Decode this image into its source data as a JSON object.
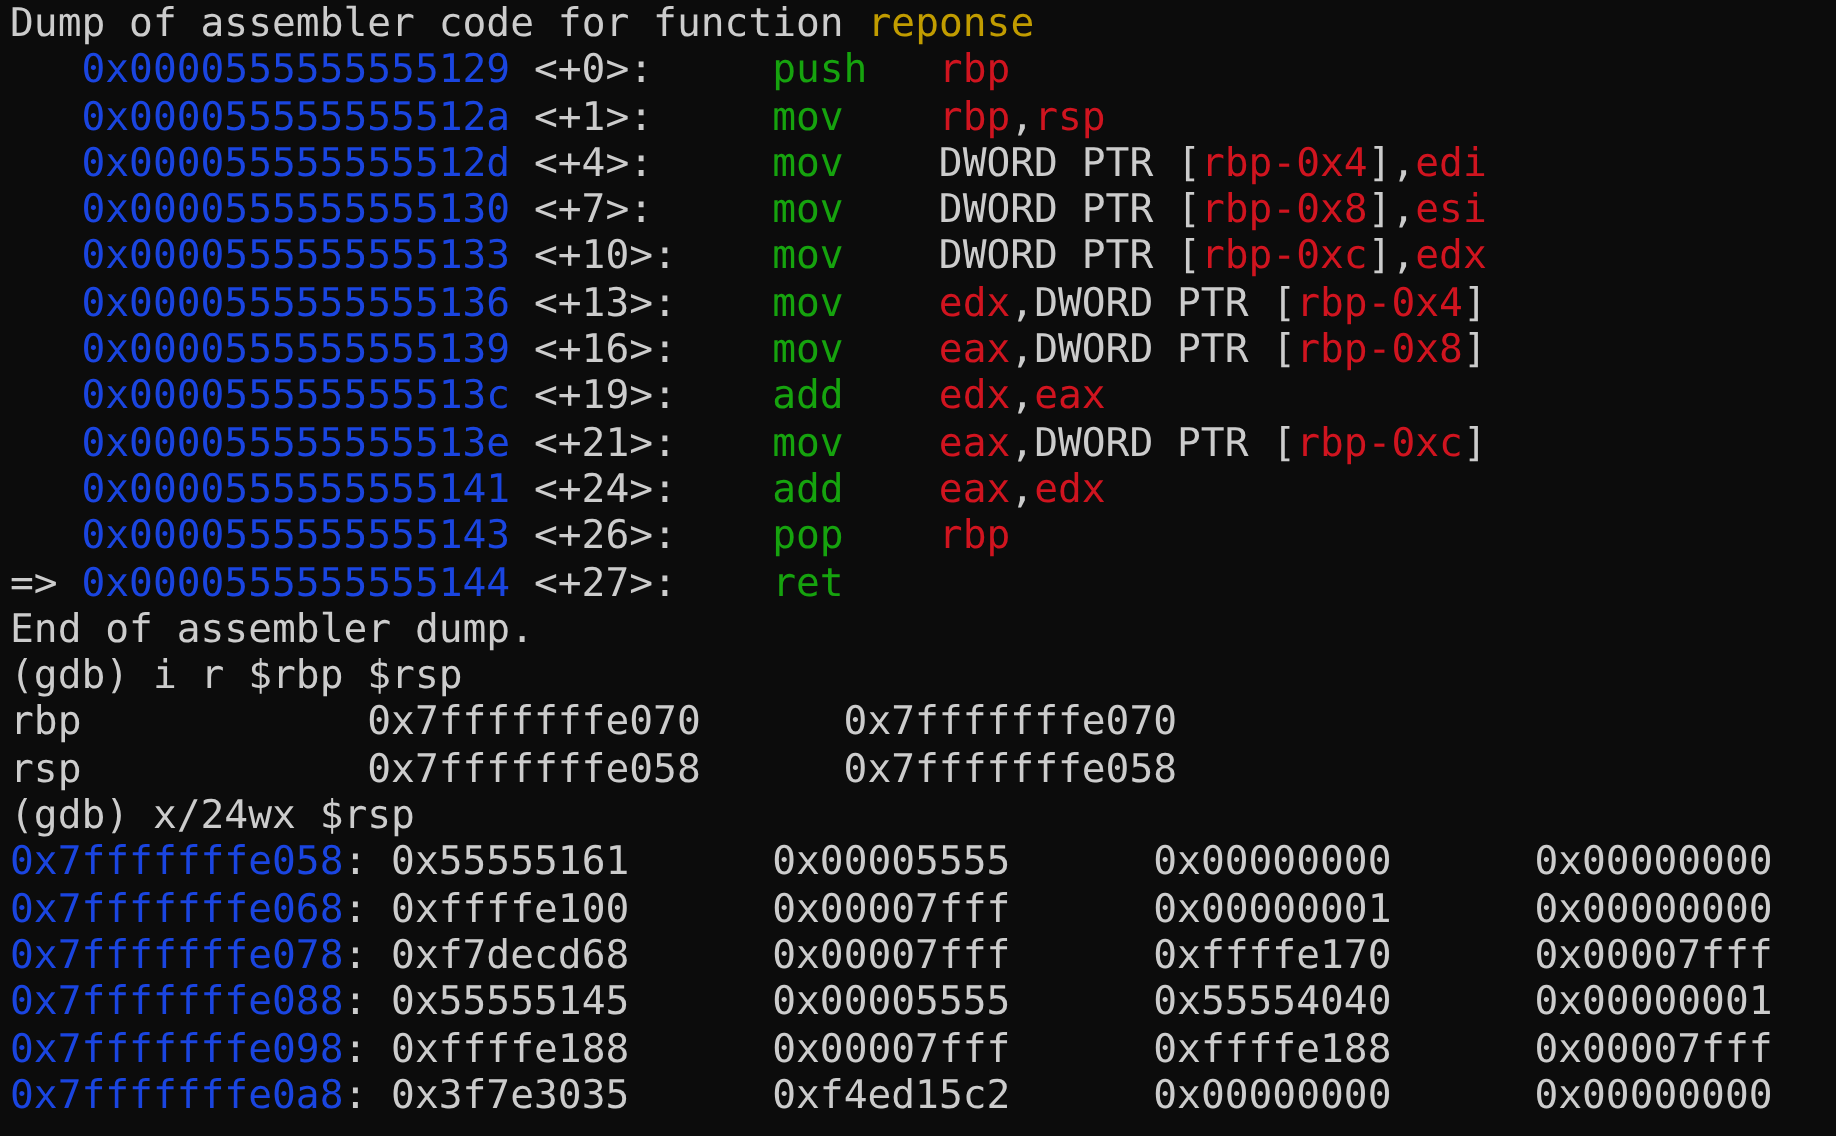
{
  "disassembly_header": {
    "text": "Dump of assembler code for function ",
    "function": "reponse"
  },
  "disassembly": [
    {
      "address": "0x0000555555555129",
      "offset": "<+0>:",
      "mnemonic": "push",
      "operands": [
        {
          "text": "rbp",
          "kind": "register"
        }
      ]
    },
    {
      "address": "0x000055555555512a",
      "offset": "<+1>:",
      "mnemonic": "mov",
      "operands": [
        {
          "text": "rbp",
          "kind": "register"
        },
        {
          "text": ",",
          "kind": "plain"
        },
        {
          "text": "rsp",
          "kind": "register"
        }
      ]
    },
    {
      "address": "0x000055555555512d",
      "offset": "<+4>:",
      "mnemonic": "mov",
      "operands": [
        {
          "text": "DWORD PTR [",
          "kind": "plain"
        },
        {
          "text": "rbp-0x4",
          "kind": "register"
        },
        {
          "text": "],",
          "kind": "plain"
        },
        {
          "text": "edi",
          "kind": "register"
        }
      ]
    },
    {
      "address": "0x0000555555555130",
      "offset": "<+7>:",
      "mnemonic": "mov",
      "operands": [
        {
          "text": "DWORD PTR [",
          "kind": "plain"
        },
        {
          "text": "rbp-0x8",
          "kind": "register"
        },
        {
          "text": "],",
          "kind": "plain"
        },
        {
          "text": "esi",
          "kind": "register"
        }
      ]
    },
    {
      "address": "0x0000555555555133",
      "offset": "<+10>:",
      "mnemonic": "mov",
      "operands": [
        {
          "text": "DWORD PTR [",
          "kind": "plain"
        },
        {
          "text": "rbp-0xc",
          "kind": "register"
        },
        {
          "text": "],",
          "kind": "plain"
        },
        {
          "text": "edx",
          "kind": "register"
        }
      ]
    },
    {
      "address": "0x0000555555555136",
      "offset": "<+13>:",
      "mnemonic": "mov",
      "operands": [
        {
          "text": "edx",
          "kind": "register"
        },
        {
          "text": ",DWORD PTR [",
          "kind": "plain"
        },
        {
          "text": "rbp-0x4",
          "kind": "register"
        },
        {
          "text": "]",
          "kind": "plain"
        }
      ]
    },
    {
      "address": "0x0000555555555139",
      "offset": "<+16>:",
      "mnemonic": "mov",
      "operands": [
        {
          "text": "eax",
          "kind": "register"
        },
        {
          "text": ",DWORD PTR [",
          "kind": "plain"
        },
        {
          "text": "rbp-0x8",
          "kind": "register"
        },
        {
          "text": "]",
          "kind": "plain"
        }
      ]
    },
    {
      "address": "0x000055555555513c",
      "offset": "<+19>:",
      "mnemonic": "add",
      "operands": [
        {
          "text": "edx",
          "kind": "register"
        },
        {
          "text": ",",
          "kind": "plain"
        },
        {
          "text": "eax",
          "kind": "register"
        }
      ]
    },
    {
      "address": "0x000055555555513e",
      "offset": "<+21>:",
      "mnemonic": "mov",
      "operands": [
        {
          "text": "eax",
          "kind": "register"
        },
        {
          "text": ",DWORD PTR [",
          "kind": "plain"
        },
        {
          "text": "rbp-0xc",
          "kind": "register"
        },
        {
          "text": "]",
          "kind": "plain"
        }
      ]
    },
    {
      "address": "0x0000555555555141",
      "offset": "<+24>:",
      "mnemonic": "add",
      "operands": [
        {
          "text": "eax",
          "kind": "register"
        },
        {
          "text": ",",
          "kind": "plain"
        },
        {
          "text": "edx",
          "kind": "register"
        }
      ]
    },
    {
      "address": "0x0000555555555143",
      "offset": "<+26>:",
      "mnemonic": "pop",
      "operands": [
        {
          "text": "rbp",
          "kind": "register"
        }
      ]
    },
    {
      "marker": "=>",
      "address": "0x0000555555555144",
      "offset": "<+27>:",
      "mnemonic": "ret"
    }
  ],
  "disassembly_end": "End of assembler dump.",
  "register_command": "(gdb) i r $rbp $rsp",
  "registers": [
    {
      "name": "rbp",
      "hex": "0x7fffffffe070",
      "natural": "0x7fffffffe070"
    },
    {
      "name": "rsp",
      "hex": "0x7fffffffe058",
      "natural": "0x7fffffffe058"
    }
  ],
  "memory_command": "(gdb) x/24wx $rsp",
  "memory": [
    {
      "address": "0x7fffffffe058",
      "separator": ":",
      "words": [
        "0x55555161",
        "0x00005555",
        "0x00000000",
        "0x00000000"
      ]
    },
    {
      "address": "0x7fffffffe068",
      "separator": ":",
      "words": [
        "0xffffe100",
        "0x00007fff",
        "0x00000001",
        "0x00000000"
      ]
    },
    {
      "address": "0x7fffffffe078",
      "separator": ":",
      "words": [
        "0xf7decd68",
        "0x00007fff",
        "0xffffe170",
        "0x00007fff"
      ]
    },
    {
      "address": "0x7fffffffe088",
      "separator": ":",
      "words": [
        "0x55555145",
        "0x00005555",
        "0x55554040",
        "0x00000001"
      ]
    },
    {
      "address": "0x7fffffffe098",
      "separator": ":",
      "words": [
        "0xffffe188",
        "0x00007fff",
        "0xffffe188",
        "0x00007fff"
      ]
    },
    {
      "address": "0x7fffffffe0a8",
      "separator": ":",
      "words": [
        "0x3f7e3035",
        "0xf4ed15c2",
        "0x00000000",
        "0x00000000"
      ]
    }
  ]
}
